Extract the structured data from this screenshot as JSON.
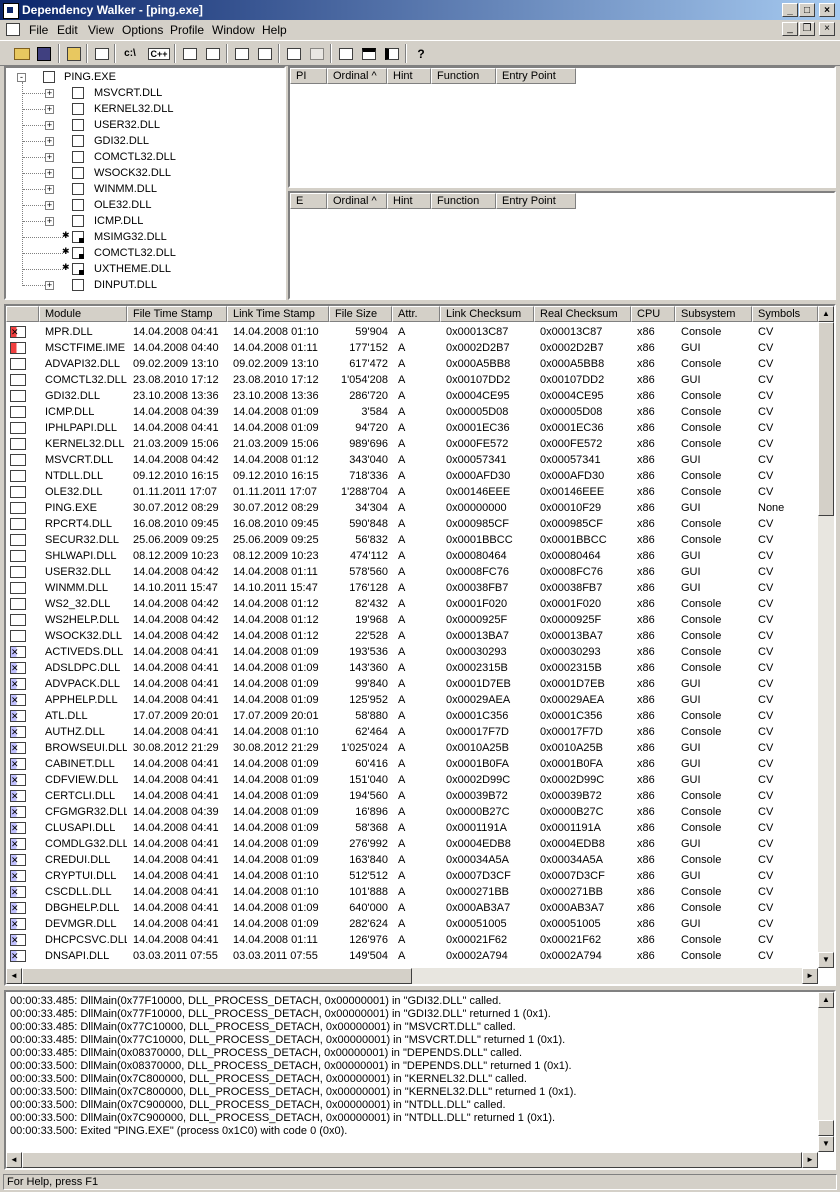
{
  "window": {
    "title": "Dependency Walker - [ping.exe]"
  },
  "menu": [
    "File",
    "Edit",
    "View",
    "Options",
    "Profile",
    "Window",
    "Help"
  ],
  "toolbar": {
    "dir_button": "c:\\",
    "cpp_button": "C++"
  },
  "tree": {
    "root": "PING.EXE",
    "children": [
      {
        "name": "MSVCRT.DLL",
        "expand": "+"
      },
      {
        "name": "KERNEL32.DLL",
        "expand": "+"
      },
      {
        "name": "USER32.DLL",
        "expand": "+"
      },
      {
        "name": "GDI32.DLL",
        "expand": "+"
      },
      {
        "name": "COMCTL32.DLL",
        "expand": "+"
      },
      {
        "name": "WSOCK32.DLL",
        "expand": "+"
      },
      {
        "name": "WINMM.DLL",
        "expand": "+"
      },
      {
        "name": "OLE32.DLL",
        "expand": "+"
      },
      {
        "name": "ICMP.DLL",
        "expand": "+"
      },
      {
        "name": "MSIMG32.DLL",
        "expand": ""
      },
      {
        "name": "COMCTL32.DLL",
        "expand": ""
      },
      {
        "name": "UXTHEME.DLL",
        "expand": ""
      },
      {
        "name": "DINPUT.DLL",
        "expand": "+"
      }
    ]
  },
  "imports_header": [
    "PI",
    "Ordinal ^",
    "Hint",
    "Function",
    "Entry Point"
  ],
  "exports_header": [
    "E",
    "Ordinal ^",
    "Hint",
    "Function",
    "Entry Point"
  ],
  "modules_header": [
    "Module",
    "File Time Stamp",
    "Link Time Stamp",
    "File Size",
    "Attr.",
    "Link Checksum",
    "Real Checksum",
    "CPU",
    "Subsystem",
    "Symbols"
  ],
  "modules": [
    [
      "MPR.DLL",
      "14.04.2008 04:41",
      "14.04.2008 01:10",
      "59'904",
      "A",
      "0x00013C87",
      "0x00013C87",
      "x86",
      "Console",
      "CV"
    ],
    [
      "MSCTFIME.IME",
      "14.04.2008 04:40",
      "14.04.2008 01:11",
      "177'152",
      "A",
      "0x0002D2B7",
      "0x0002D2B7",
      "x86",
      "GUI",
      "CV"
    ],
    [
      "ADVAPI32.DLL",
      "09.02.2009 13:10",
      "09.02.2009 13:10",
      "617'472",
      "A",
      "0x000A5BB8",
      "0x000A5BB8",
      "x86",
      "Console",
      "CV"
    ],
    [
      "COMCTL32.DLL",
      "23.08.2010 17:12",
      "23.08.2010 17:12",
      "1'054'208",
      "A",
      "0x00107DD2",
      "0x00107DD2",
      "x86",
      "GUI",
      "CV"
    ],
    [
      "GDI32.DLL",
      "23.10.2008 13:36",
      "23.10.2008 13:36",
      "286'720",
      "A",
      "0x0004CE95",
      "0x0004CE95",
      "x86",
      "Console",
      "CV"
    ],
    [
      "ICMP.DLL",
      "14.04.2008 04:39",
      "14.04.2008 01:09",
      "3'584",
      "A",
      "0x00005D08",
      "0x00005D08",
      "x86",
      "Console",
      "CV"
    ],
    [
      "IPHLPAPI.DLL",
      "14.04.2008 04:41",
      "14.04.2008 01:09",
      "94'720",
      "A",
      "0x0001EC36",
      "0x0001EC36",
      "x86",
      "Console",
      "CV"
    ],
    [
      "KERNEL32.DLL",
      "21.03.2009 15:06",
      "21.03.2009 15:06",
      "989'696",
      "A",
      "0x000FE572",
      "0x000FE572",
      "x86",
      "Console",
      "CV"
    ],
    [
      "MSVCRT.DLL",
      "14.04.2008 04:42",
      "14.04.2008 01:12",
      "343'040",
      "A",
      "0x00057341",
      "0x00057341",
      "x86",
      "GUI",
      "CV"
    ],
    [
      "NTDLL.DLL",
      "09.12.2010 16:15",
      "09.12.2010 16:15",
      "718'336",
      "A",
      "0x000AFD30",
      "0x000AFD30",
      "x86",
      "Console",
      "CV"
    ],
    [
      "OLE32.DLL",
      "01.11.2011 17:07",
      "01.11.2011 17:07",
      "1'288'704",
      "A",
      "0x00146EEE",
      "0x00146EEE",
      "x86",
      "Console",
      "CV"
    ],
    [
      "PING.EXE",
      "30.07.2012 08:29",
      "30.07.2012 08:29",
      "34'304",
      "A",
      "0x00000000",
      "0x00010F29",
      "x86",
      "GUI",
      "None"
    ],
    [
      "RPCRT4.DLL",
      "16.08.2010 09:45",
      "16.08.2010 09:45",
      "590'848",
      "A",
      "0x000985CF",
      "0x000985CF",
      "x86",
      "Console",
      "CV"
    ],
    [
      "SECUR32.DLL",
      "25.06.2009 09:25",
      "25.06.2009 09:25",
      "56'832",
      "A",
      "0x0001BBCC",
      "0x0001BBCC",
      "x86",
      "Console",
      "CV"
    ],
    [
      "SHLWAPI.DLL",
      "08.12.2009 10:23",
      "08.12.2009 10:23",
      "474'112",
      "A",
      "0x00080464",
      "0x00080464",
      "x86",
      "GUI",
      "CV"
    ],
    [
      "USER32.DLL",
      "14.04.2008 04:42",
      "14.04.2008 01:11",
      "578'560",
      "A",
      "0x0008FC76",
      "0x0008FC76",
      "x86",
      "GUI",
      "CV"
    ],
    [
      "WINMM.DLL",
      "14.10.2011 15:47",
      "14.10.2011 15:47",
      "176'128",
      "A",
      "0x00038FB7",
      "0x00038FB7",
      "x86",
      "GUI",
      "CV"
    ],
    [
      "WS2_32.DLL",
      "14.04.2008 04:42",
      "14.04.2008 01:12",
      "82'432",
      "A",
      "0x0001F020",
      "0x0001F020",
      "x86",
      "Console",
      "CV"
    ],
    [
      "WS2HELP.DLL",
      "14.04.2008 04:42",
      "14.04.2008 01:12",
      "19'968",
      "A",
      "0x0000925F",
      "0x0000925F",
      "x86",
      "Console",
      "CV"
    ],
    [
      "WSOCK32.DLL",
      "14.04.2008 04:42",
      "14.04.2008 01:12",
      "22'528",
      "A",
      "0x00013BA7",
      "0x00013BA7",
      "x86",
      "Console",
      "CV"
    ],
    [
      "ACTIVEDS.DLL",
      "14.04.2008 04:41",
      "14.04.2008 01:09",
      "193'536",
      "A",
      "0x00030293",
      "0x00030293",
      "x86",
      "Console",
      "CV"
    ],
    [
      "ADSLDPC.DLL",
      "14.04.2008 04:41",
      "14.04.2008 01:09",
      "143'360",
      "A",
      "0x0002315B",
      "0x0002315B",
      "x86",
      "Console",
      "CV"
    ],
    [
      "ADVPACK.DLL",
      "14.04.2008 04:41",
      "14.04.2008 01:09",
      "99'840",
      "A",
      "0x0001D7EB",
      "0x0001D7EB",
      "x86",
      "GUI",
      "CV"
    ],
    [
      "APPHELP.DLL",
      "14.04.2008 04:41",
      "14.04.2008 01:09",
      "125'952",
      "A",
      "0x00029AEA",
      "0x00029AEA",
      "x86",
      "GUI",
      "CV"
    ],
    [
      "ATL.DLL",
      "17.07.2009 20:01",
      "17.07.2009 20:01",
      "58'880",
      "A",
      "0x0001C356",
      "0x0001C356",
      "x86",
      "Console",
      "CV"
    ],
    [
      "AUTHZ.DLL",
      "14.04.2008 04:41",
      "14.04.2008 01:10",
      "62'464",
      "A",
      "0x00017F7D",
      "0x00017F7D",
      "x86",
      "Console",
      "CV"
    ],
    [
      "BROWSEUI.DLL",
      "30.08.2012 21:29",
      "30.08.2012 21:29",
      "1'025'024",
      "A",
      "0x0010A25B",
      "0x0010A25B",
      "x86",
      "GUI",
      "CV"
    ],
    [
      "CABINET.DLL",
      "14.04.2008 04:41",
      "14.04.2008 01:09",
      "60'416",
      "A",
      "0x0001B0FA",
      "0x0001B0FA",
      "x86",
      "GUI",
      "CV"
    ],
    [
      "CDFVIEW.DLL",
      "14.04.2008 04:41",
      "14.04.2008 01:09",
      "151'040",
      "A",
      "0x0002D99C",
      "0x0002D99C",
      "x86",
      "GUI",
      "CV"
    ],
    [
      "CERTCLI.DLL",
      "14.04.2008 04:41",
      "14.04.2008 01:09",
      "194'560",
      "A",
      "0x00039B72",
      "0x00039B72",
      "x86",
      "Console",
      "CV"
    ],
    [
      "CFGMGR32.DLL",
      "14.04.2008 04:39",
      "14.04.2008 01:09",
      "16'896",
      "A",
      "0x0000B27C",
      "0x0000B27C",
      "x86",
      "Console",
      "CV"
    ],
    [
      "CLUSAPI.DLL",
      "14.04.2008 04:41",
      "14.04.2008 01:09",
      "58'368",
      "A",
      "0x0001191A",
      "0x0001191A",
      "x86",
      "Console",
      "CV"
    ],
    [
      "COMDLG32.DLL",
      "14.04.2008 04:41",
      "14.04.2008 01:09",
      "276'992",
      "A",
      "0x0004EDB8",
      "0x0004EDB8",
      "x86",
      "GUI",
      "CV"
    ],
    [
      "CREDUI.DLL",
      "14.04.2008 04:41",
      "14.04.2008 01:09",
      "163'840",
      "A",
      "0x00034A5A",
      "0x00034A5A",
      "x86",
      "Console",
      "CV"
    ],
    [
      "CRYPTUI.DLL",
      "14.04.2008 04:41",
      "14.04.2008 01:10",
      "512'512",
      "A",
      "0x0007D3CF",
      "0x0007D3CF",
      "x86",
      "GUI",
      "CV"
    ],
    [
      "CSCDLL.DLL",
      "14.04.2008 04:41",
      "14.04.2008 01:10",
      "101'888",
      "A",
      "0x000271BB",
      "0x000271BB",
      "x86",
      "Console",
      "CV"
    ],
    [
      "DBGHELP.DLL",
      "14.04.2008 04:41",
      "14.04.2008 01:09",
      "640'000",
      "A",
      "0x000AB3A7",
      "0x000AB3A7",
      "x86",
      "Console",
      "CV"
    ],
    [
      "DEVMGR.DLL",
      "14.04.2008 04:41",
      "14.04.2008 01:09",
      "282'624",
      "A",
      "0x00051005",
      "0x00051005",
      "x86",
      "GUI",
      "CV"
    ],
    [
      "DHCPCSVC.DLL",
      "14.04.2008 04:41",
      "14.04.2008 01:11",
      "126'976",
      "A",
      "0x00021F62",
      "0x00021F62",
      "x86",
      "Console",
      "CV"
    ],
    [
      "DNSAPI.DLL",
      "03.03.2011 07:55",
      "03.03.2011 07:55",
      "149'504",
      "A",
      "0x0002A794",
      "0x0002A794",
      "x86",
      "Console",
      "CV"
    ]
  ],
  "log": [
    "00:00:33.485: DllMain(0x77F10000, DLL_PROCESS_DETACH, 0x00000001) in \"GDI32.DLL\" called.",
    "00:00:33.485: DllMain(0x77F10000, DLL_PROCESS_DETACH, 0x00000001) in \"GDI32.DLL\" returned 1 (0x1).",
    "00:00:33.485: DllMain(0x77C10000, DLL_PROCESS_DETACH, 0x00000001) in \"MSVCRT.DLL\" called.",
    "00:00:33.485: DllMain(0x77C10000, DLL_PROCESS_DETACH, 0x00000001) in \"MSVCRT.DLL\" returned 1 (0x1).",
    "00:00:33.485: DllMain(0x08370000, DLL_PROCESS_DETACH, 0x00000001) in \"DEPENDS.DLL\" called.",
    "00:00:33.500: DllMain(0x08370000, DLL_PROCESS_DETACH, 0x00000001) in \"DEPENDS.DLL\" returned 1 (0x1).",
    "00:00:33.500: DllMain(0x7C800000, DLL_PROCESS_DETACH, 0x00000001) in \"KERNEL32.DLL\" called.",
    "00:00:33.500: DllMain(0x7C800000, DLL_PROCESS_DETACH, 0x00000001) in \"KERNEL32.DLL\" returned 1 (0x1).",
    "00:00:33.500: DllMain(0x7C900000, DLL_PROCESS_DETACH, 0x00000001) in \"NTDLL.DLL\" called.",
    "00:00:33.500: DllMain(0x7C900000, DLL_PROCESS_DETACH, 0x00000001) in \"NTDLL.DLL\" returned 1 (0x1).",
    "00:00:33.500: Exited \"PING.EXE\" (process 0x1C0) with code 0 (0x0)."
  ],
  "status": "For Help, press F1"
}
